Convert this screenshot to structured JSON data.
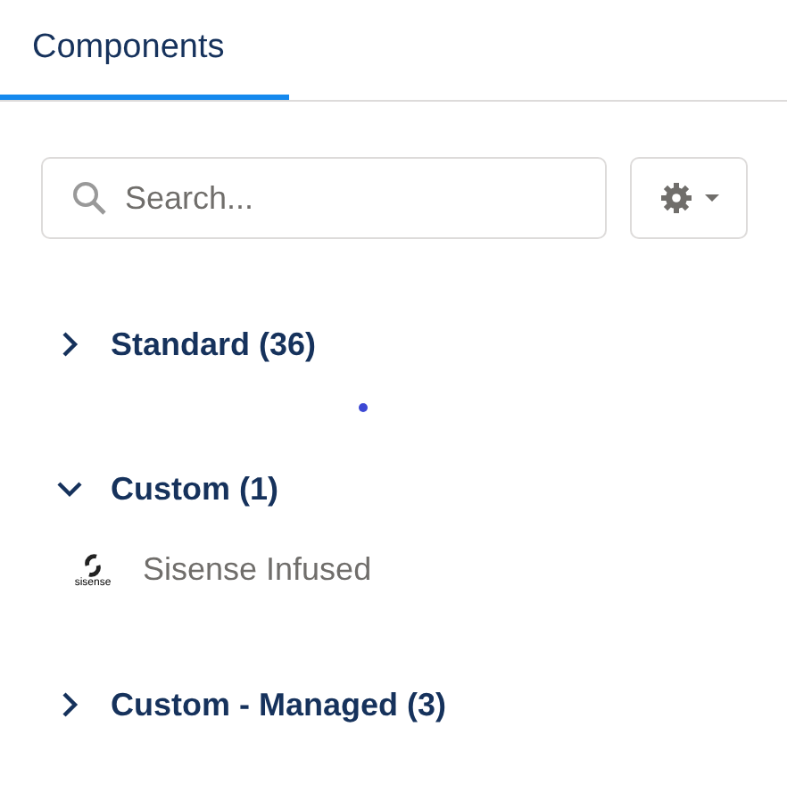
{
  "tabs": [
    {
      "label": "Components",
      "selected": true
    }
  ],
  "search": {
    "placeholder": "Search..."
  },
  "sections": [
    {
      "label": "Standard (36)",
      "expanded": false
    },
    {
      "label": "Custom (1)",
      "expanded": true,
      "items": [
        {
          "name": "Sisense Infused",
          "logo_text": "sisense"
        }
      ]
    },
    {
      "label": "Custom - Managed (3)",
      "expanded": false
    }
  ]
}
